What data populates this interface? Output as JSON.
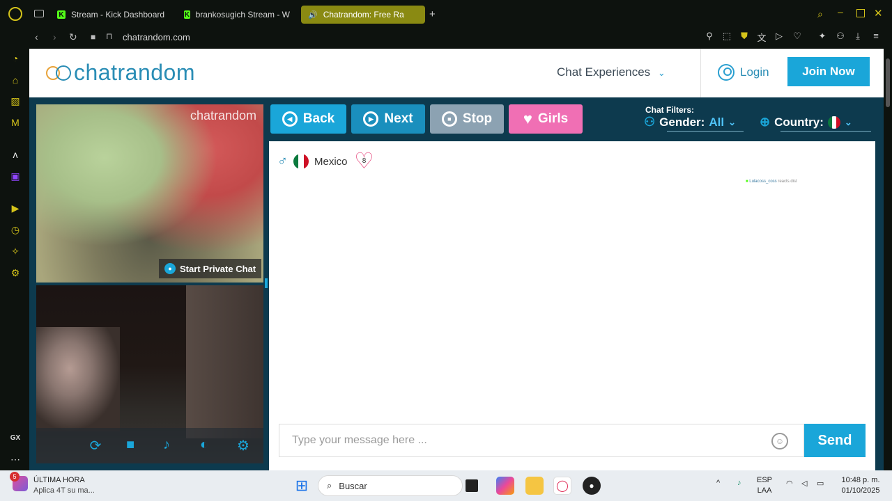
{
  "browser": {
    "tabs": [
      {
        "label": "Stream - Kick Dashboard"
      },
      {
        "label": "brankosugich Stream - W"
      },
      {
        "label": "Chatrandom: Free Ra"
      }
    ],
    "address": "chatrandom.com"
  },
  "header": {
    "logo": "chatrandom",
    "chat_experiences": "Chat Experiences",
    "login": "Login",
    "join": "Join Now"
  },
  "video": {
    "watermark": "chatrandom",
    "private_chat": "Start Private Chat"
  },
  "controls": {
    "back": "Back",
    "next": "Next",
    "stop": "Stop",
    "girls": "Girls"
  },
  "filters": {
    "label": "Chat Filters:",
    "gender_label": "Gender:",
    "gender_value": "All",
    "country_label": "Country:"
  },
  "partner": {
    "country": "Mexico",
    "hearts": "8"
  },
  "chat": {
    "tiny_user": "Lulacoss_coss",
    "tiny_text": "reacts.dist",
    "placeholder": "Type your message here ...",
    "send": "Send"
  },
  "taskbar": {
    "news_badge": "5",
    "news_title": "ÚLTIMA HORA",
    "news_sub": "Aplica 4T su ma...",
    "search": "Buscar",
    "lang1": "ESP",
    "lang2": "LAA",
    "time": "10:48 p. m.",
    "date": "01/10/2025"
  },
  "sidebar": {
    "gx": "GX"
  },
  "colors": {
    "accent": "#1aa6d9",
    "girls": "#f06fb4",
    "stop": "#8ca2b2",
    "page_bg": "#0d3a4e"
  }
}
